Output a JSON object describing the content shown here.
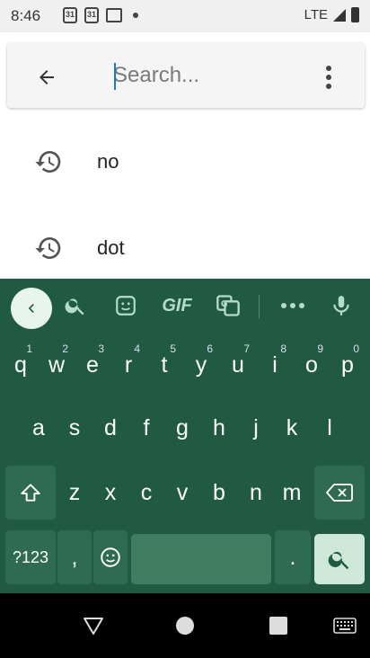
{
  "status_bar": {
    "time": "8:46",
    "calendar_day_1": "31",
    "calendar_day_2": "31",
    "network": "LTE"
  },
  "search": {
    "placeholder": "Search..."
  },
  "suggestions": [
    {
      "label": "no"
    },
    {
      "label": "dot"
    }
  ],
  "keyboard": {
    "tools": {
      "gif": "GIF"
    },
    "row1": [
      {
        "k": "q",
        "n": "1"
      },
      {
        "k": "w",
        "n": "2"
      },
      {
        "k": "e",
        "n": "3"
      },
      {
        "k": "r",
        "n": "4"
      },
      {
        "k": "t",
        "n": "5"
      },
      {
        "k": "y",
        "n": "6"
      },
      {
        "k": "u",
        "n": "7"
      },
      {
        "k": "i",
        "n": "8"
      },
      {
        "k": "o",
        "n": "9"
      },
      {
        "k": "p",
        "n": "0"
      }
    ],
    "row2": [
      "a",
      "s",
      "d",
      "f",
      "g",
      "h",
      "j",
      "k",
      "l"
    ],
    "row3": [
      "z",
      "x",
      "c",
      "v",
      "b",
      "n",
      "m"
    ],
    "symbols_label": "?123",
    "comma": ",",
    "period": "."
  },
  "colors": {
    "keyboard_bg": "#205a42",
    "accent": "#1a73e8"
  }
}
